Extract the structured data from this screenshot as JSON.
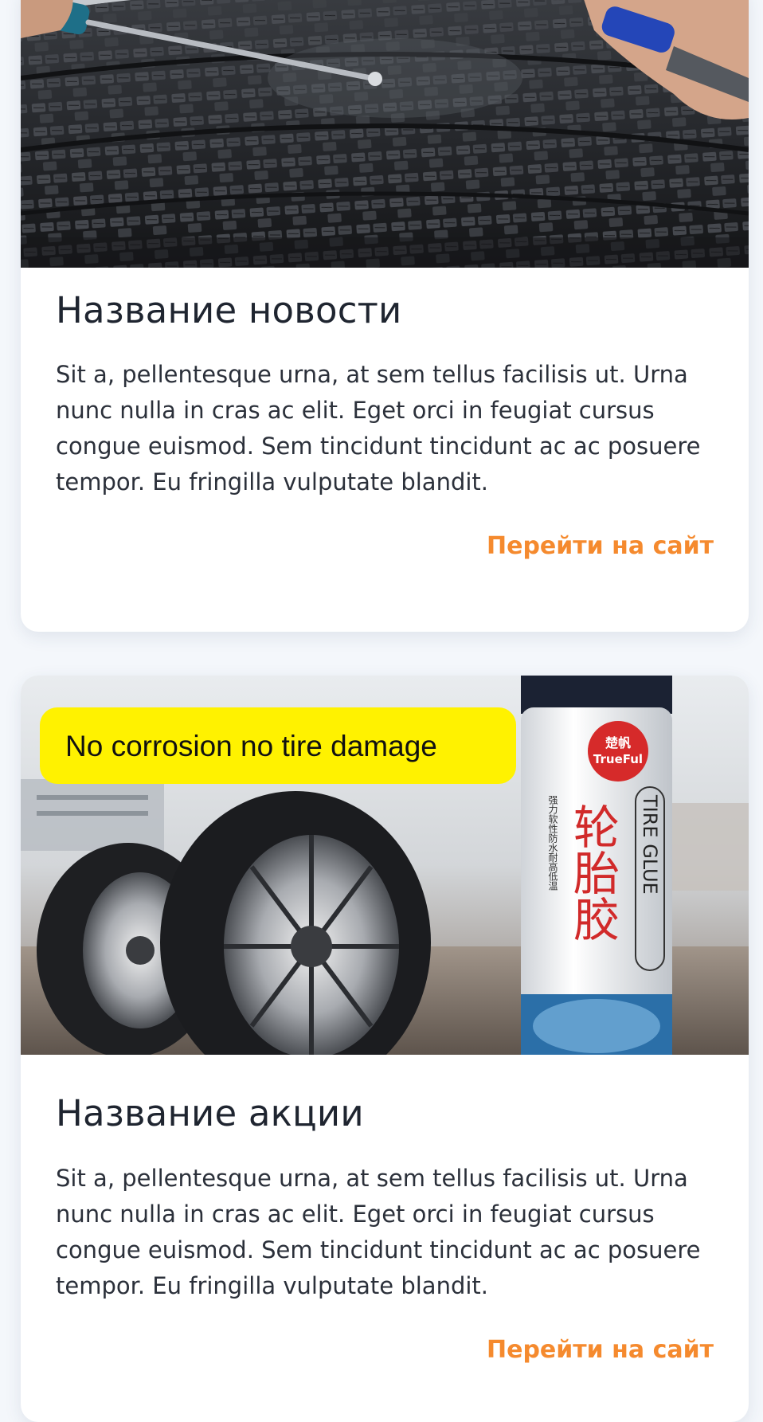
{
  "cards": [
    {
      "title": "Название новости",
      "text": "Sit a, pellentesque urna, at sem tellus facilisis ut. Urna nunc nulla in cras ac elit. Eget orci in feugiat cursus congue euismod. Sem tincidunt tincidunt ac ac posuere tempor. Eu fringilla vulputate blandit.",
      "link": "Перейти на сайт",
      "image_icon": "tire-repair-photo"
    },
    {
      "title": "Название акции",
      "text": "Sit a, pellentesque urna, at sem tellus facilisis ut. Urna nunc nulla in cras ac elit. Eget orci in feugiat cursus congue euismod. Sem tincidunt tincidunt ac ac posuere tempor. Eu fringilla vulputate blandit.",
      "link": "Перейти на сайт",
      "image_icon": "tire-glue-promo-photo",
      "image_texts": {
        "badge": "No corrosion no tire damage",
        "brand_cn": "楚帆",
        "brand": "TrueFul",
        "product_cn": "轮胎胶",
        "product_en": "TIRE GLUE",
        "subtitle_cn": "强力软性防水耐高低温"
      }
    }
  ],
  "colors": {
    "background": "#f4f7fb",
    "card": "#ffffff",
    "title": "#1f2530",
    "text": "#2b303a",
    "link": "#f58a2e",
    "badge": "#fff200"
  }
}
